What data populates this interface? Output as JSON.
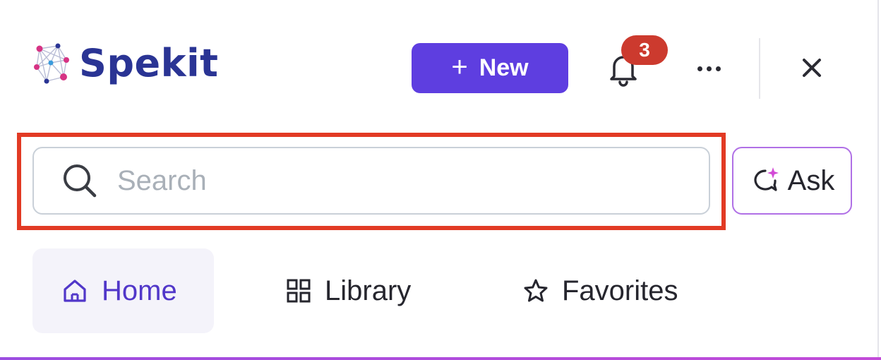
{
  "brand": {
    "name": "Spekit",
    "logo_icon": "spekit-network-logo",
    "color": "#2a3494"
  },
  "header": {
    "new_button": {
      "icon": "plus-icon",
      "label": "New",
      "color": "#5e3ee0"
    },
    "notifications": {
      "icon": "bell-icon",
      "badge_count": "3",
      "badge_color": "#cc3a2e"
    },
    "more_icon": "more-horizontal-icon",
    "close_icon": "close-icon"
  },
  "search": {
    "icon": "search-icon",
    "placeholder": "Search",
    "value": "",
    "highlight_color": "#e23a24"
  },
  "ask": {
    "icon": "ai-chat-sparkle-icon",
    "label": "Ask",
    "border_color": "#b070e6"
  },
  "tabs": [
    {
      "icon": "home-icon",
      "label": "Home",
      "active": true
    },
    {
      "icon": "grid-icon",
      "label": "Library",
      "active": false
    },
    {
      "icon": "star-icon",
      "label": "Favorites",
      "active": false
    }
  ],
  "colors": {
    "accent": "#5e3ee0",
    "active_tab_text": "#5137c9",
    "active_tab_bg": "#f4f3fa"
  }
}
